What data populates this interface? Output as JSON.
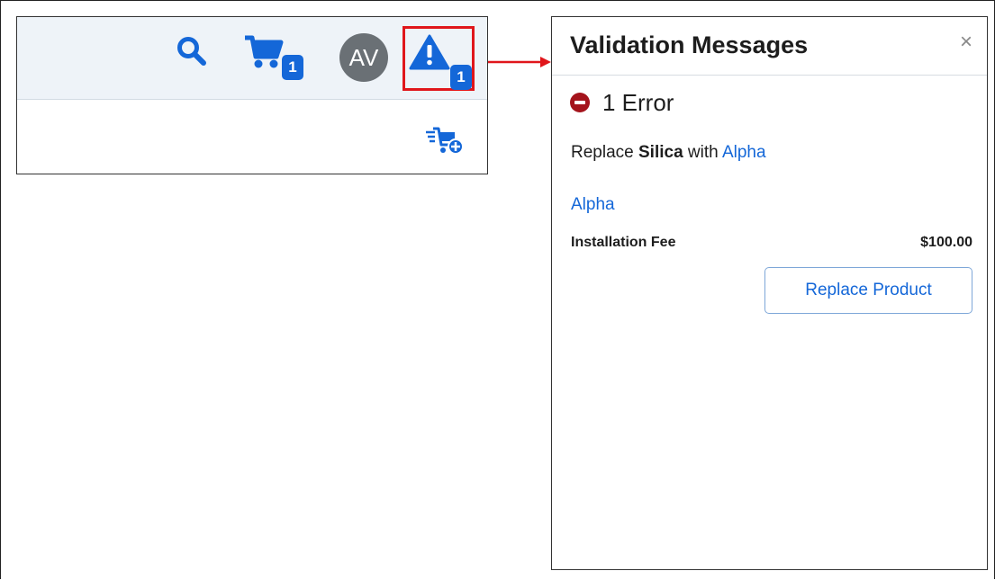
{
  "header": {
    "avatar_initials": "AV",
    "cart_badge": "1",
    "alert_badge": "1",
    "icons": {
      "search": "search-icon",
      "cart": "cart-icon",
      "alert": "warning-triangle-icon",
      "add_to_cart": "cart-add-icon"
    }
  },
  "panel": {
    "title": "Validation Messages",
    "close_label": "×",
    "error_count": "1 Error",
    "message": {
      "prefix": "Replace ",
      "product_from": "Silica",
      "middle": " with ",
      "product_to": "Alpha"
    },
    "product_name": "Alpha",
    "fee_label": "Installation Fee",
    "fee_amount": "$100.00",
    "replace_button": "Replace Product"
  },
  "colors": {
    "accent": "#1467d8",
    "error": "#a4141c",
    "highlight_border": "#e0161b",
    "avatar_bg": "#6a7075",
    "toolbar_bg": "#eef3f8"
  }
}
